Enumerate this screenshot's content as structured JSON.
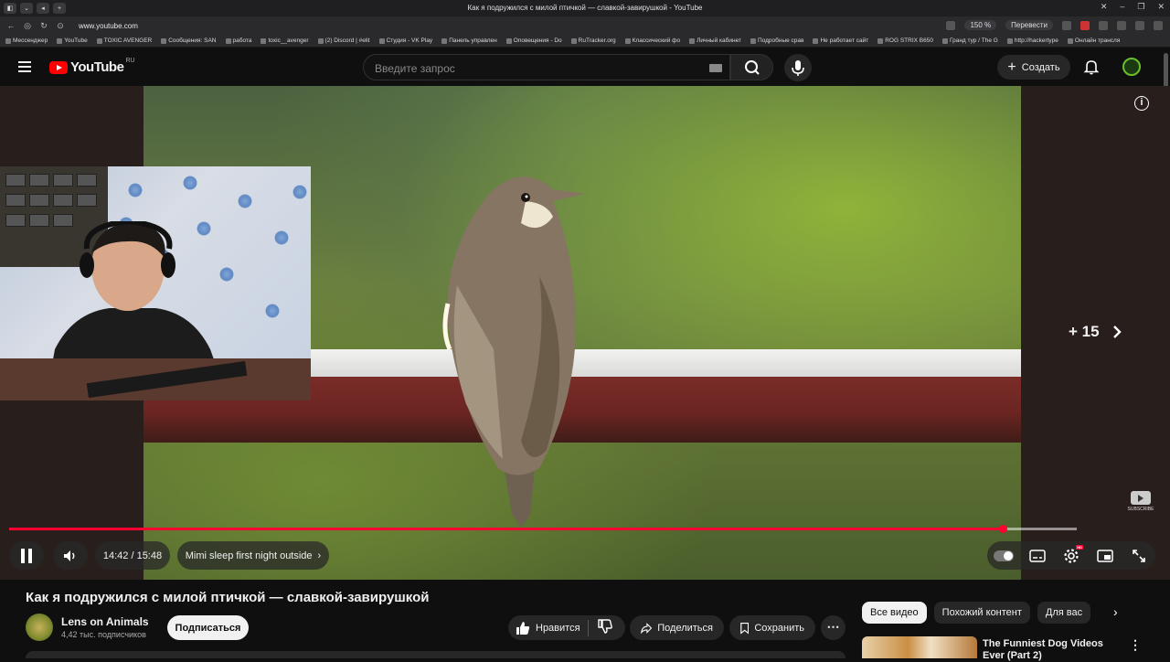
{
  "browser": {
    "tab_title": "Как я подружился с милой птичкой — славкой-завирушкой - YouTube",
    "url": "www.youtube.com",
    "zoom": "150 %",
    "translate": "Перевести",
    "bookmarks": [
      "Мессенджер",
      "YouTube",
      "TOXIC AVENGER",
      "Сообщения: SAN",
      "работа",
      "toxic__avenger",
      "(2) Discord | #elit",
      "Студия - VK Play",
      "Панель управлен",
      "Оповещения - Do",
      "RuTracker.org",
      "Классический фо",
      "Личный кабинет",
      "Подробные срав",
      "Не работает сайт",
      "ROG STRIX B650",
      "Гранд тур / The G",
      "http://hackertype",
      "Онлайн трансля"
    ]
  },
  "header": {
    "logo": "YouTube",
    "region": "RU",
    "search_placeholder": "Введите запрос",
    "create_label": "Создать"
  },
  "player": {
    "skip_label": "+ 15",
    "time": "14:42 / 15:48",
    "chapter": "Mimi sleep first night outside",
    "progress": 0.9303,
    "watermark": "SUBSCRIBE"
  },
  "video": {
    "title": "Как я подружился с милой птичкой — славкой-завирушкой",
    "channel": "Lens on Animals",
    "subscribers": "4,42 тыс. подписчиков",
    "subscribe_label": "Подписаться",
    "like_label": "Нравится",
    "share_label": "Поделиться",
    "save_label": "Сохранить"
  },
  "sidebar": {
    "chips": [
      "Все видео",
      "Похожий контент",
      "Для вас"
    ],
    "rec_title": "The Funniest Dog Videos Ever (Part 2)"
  },
  "colors": {
    "accent": "#ff0033",
    "brand": "#ff0000",
    "bg": "#0f0f0f"
  }
}
